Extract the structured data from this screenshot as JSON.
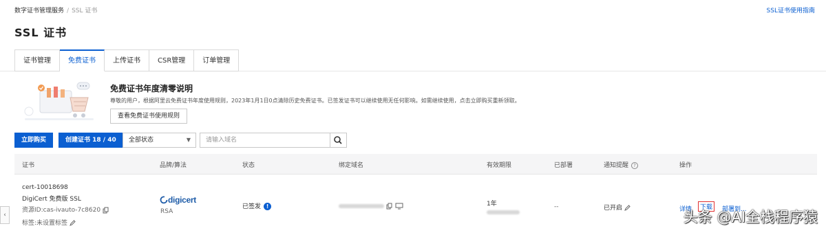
{
  "breadcrumb": {
    "root": "数字证书管理服务",
    "separator": "/",
    "current": "SSL 证书"
  },
  "header": {
    "guide_link": "SSL证书使用指南",
    "title": "SSL 证书"
  },
  "tabs": [
    {
      "label": "证书管理"
    },
    {
      "label": "免费证书",
      "active": true
    },
    {
      "label": "上传证书"
    },
    {
      "label": "CSR管理"
    },
    {
      "label": "订单管理"
    }
  ],
  "notice": {
    "title": "免费证书年度清零说明",
    "text": "尊敬的用户，根据阿里云免费证书年度使用规则，2023年1月1日0点清除历史免费证书。已签发证书可以继续使用无任何影响。如需继续使用，点击立即购买重新领取。",
    "button": "查看免费证书使用规则"
  },
  "toolbar": {
    "buy_button": "立即购买",
    "create_button": "创建证书 18 / 40",
    "status_select": "全部状态",
    "search_placeholder": "请输入域名"
  },
  "table": {
    "headers": [
      "证书",
      "品牌/算法",
      "状态",
      "绑定域名",
      "有效期限",
      "已部署",
      "通知提醒",
      "操作"
    ],
    "rows": [
      {
        "cert_name": "cert-10018698",
        "cert_product": "DigiCert 免费版 SSL",
        "resource_id": "资源ID:cas-ivauto-7c8620",
        "tag": "标签:未设置标签",
        "brand": "digicert",
        "algorithm": "RSA",
        "status": "已签发",
        "validity": "1年",
        "deployed": "--",
        "notify": "已开启",
        "actions": {
          "detail": "详情",
          "download": "下载",
          "deploy": "部署到..."
        }
      }
    ]
  },
  "watermark": "头条 @AI全栈程序猿",
  "colors": {
    "accent": "#0b5fd1",
    "highlight": "#e03030"
  }
}
